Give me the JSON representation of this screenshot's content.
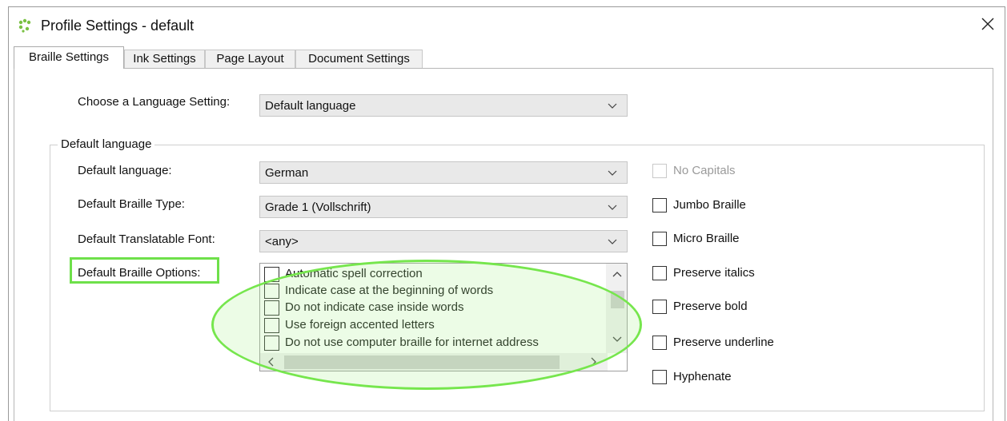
{
  "window": {
    "title": "Profile Settings - default",
    "app_icon": "app-logo-icon",
    "close_icon": "close-icon"
  },
  "tabs": [
    {
      "label": "Braille Settings",
      "active": true
    },
    {
      "label": "Ink Settings",
      "active": false
    },
    {
      "label": "Page Layout",
      "active": false
    },
    {
      "label": "Document Settings",
      "active": false
    }
  ],
  "language_setting": {
    "label": "Choose a Language Setting:",
    "value": "Default language"
  },
  "group": {
    "title": "Default language",
    "default_language": {
      "label": "Default language:",
      "value": "German"
    },
    "braille_type": {
      "label": "Default Braille Type:",
      "value": "Grade 1 (Vollschrift)"
    },
    "translatable_font": {
      "label": "Default Translatable Font:",
      "value": "<any>"
    },
    "braille_options": {
      "label": "Default Braille Options:",
      "items": [
        "Automatic spell correction",
        "Indicate case at the beginning of words",
        "Do not indicate case inside words",
        "Use foreign accented letters",
        "Do not use computer braille for internet address"
      ]
    },
    "right_options": [
      {
        "label": "No Capitals",
        "checked": false,
        "disabled": true
      },
      {
        "label": "Jumbo Braille",
        "checked": false,
        "disabled": false
      },
      {
        "label": "Micro Braille",
        "checked": false,
        "disabled": false
      },
      {
        "label": "Preserve italics",
        "checked": false,
        "disabled": false
      },
      {
        "label": "Preserve bold",
        "checked": false,
        "disabled": false
      },
      {
        "label": "Preserve underline",
        "checked": false,
        "disabled": false
      },
      {
        "label": "Hyphenate",
        "checked": false,
        "disabled": false
      }
    ]
  },
  "colors": {
    "highlight": "#6ee04a",
    "brand_green": "#7ac143"
  }
}
